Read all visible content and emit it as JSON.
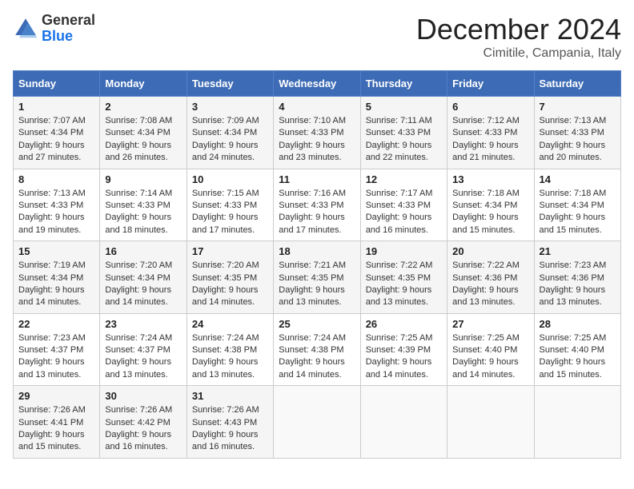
{
  "logo": {
    "general": "General",
    "blue": "Blue"
  },
  "header": {
    "month": "December 2024",
    "location": "Cimitile, Campania, Italy"
  },
  "weekdays": [
    "Sunday",
    "Monday",
    "Tuesday",
    "Wednesday",
    "Thursday",
    "Friday",
    "Saturday"
  ],
  "weeks": [
    [
      {
        "day": 1,
        "sunrise": "7:07 AM",
        "sunset": "4:34 PM",
        "daylight": "9 hours and 27 minutes."
      },
      {
        "day": 2,
        "sunrise": "7:08 AM",
        "sunset": "4:34 PM",
        "daylight": "9 hours and 26 minutes."
      },
      {
        "day": 3,
        "sunrise": "7:09 AM",
        "sunset": "4:34 PM",
        "daylight": "9 hours and 24 minutes."
      },
      {
        "day": 4,
        "sunrise": "7:10 AM",
        "sunset": "4:33 PM",
        "daylight": "9 hours and 23 minutes."
      },
      {
        "day": 5,
        "sunrise": "7:11 AM",
        "sunset": "4:33 PM",
        "daylight": "9 hours and 22 minutes."
      },
      {
        "day": 6,
        "sunrise": "7:12 AM",
        "sunset": "4:33 PM",
        "daylight": "9 hours and 21 minutes."
      },
      {
        "day": 7,
        "sunrise": "7:13 AM",
        "sunset": "4:33 PM",
        "daylight": "9 hours and 20 minutes."
      }
    ],
    [
      {
        "day": 8,
        "sunrise": "7:13 AM",
        "sunset": "4:33 PM",
        "daylight": "9 hours and 19 minutes."
      },
      {
        "day": 9,
        "sunrise": "7:14 AM",
        "sunset": "4:33 PM",
        "daylight": "9 hours and 18 minutes."
      },
      {
        "day": 10,
        "sunrise": "7:15 AM",
        "sunset": "4:33 PM",
        "daylight": "9 hours and 17 minutes."
      },
      {
        "day": 11,
        "sunrise": "7:16 AM",
        "sunset": "4:33 PM",
        "daylight": "9 hours and 17 minutes."
      },
      {
        "day": 12,
        "sunrise": "7:17 AM",
        "sunset": "4:33 PM",
        "daylight": "9 hours and 16 minutes."
      },
      {
        "day": 13,
        "sunrise": "7:18 AM",
        "sunset": "4:34 PM",
        "daylight": "9 hours and 15 minutes."
      },
      {
        "day": 14,
        "sunrise": "7:18 AM",
        "sunset": "4:34 PM",
        "daylight": "9 hours and 15 minutes."
      }
    ],
    [
      {
        "day": 15,
        "sunrise": "7:19 AM",
        "sunset": "4:34 PM",
        "daylight": "9 hours and 14 minutes."
      },
      {
        "day": 16,
        "sunrise": "7:20 AM",
        "sunset": "4:34 PM",
        "daylight": "9 hours and 14 minutes."
      },
      {
        "day": 17,
        "sunrise": "7:20 AM",
        "sunset": "4:35 PM",
        "daylight": "9 hours and 14 minutes."
      },
      {
        "day": 18,
        "sunrise": "7:21 AM",
        "sunset": "4:35 PM",
        "daylight": "9 hours and 13 minutes."
      },
      {
        "day": 19,
        "sunrise": "7:22 AM",
        "sunset": "4:35 PM",
        "daylight": "9 hours and 13 minutes."
      },
      {
        "day": 20,
        "sunrise": "7:22 AM",
        "sunset": "4:36 PM",
        "daylight": "9 hours and 13 minutes."
      },
      {
        "day": 21,
        "sunrise": "7:23 AM",
        "sunset": "4:36 PM",
        "daylight": "9 hours and 13 minutes."
      }
    ],
    [
      {
        "day": 22,
        "sunrise": "7:23 AM",
        "sunset": "4:37 PM",
        "daylight": "9 hours and 13 minutes."
      },
      {
        "day": 23,
        "sunrise": "7:24 AM",
        "sunset": "4:37 PM",
        "daylight": "9 hours and 13 minutes."
      },
      {
        "day": 24,
        "sunrise": "7:24 AM",
        "sunset": "4:38 PM",
        "daylight": "9 hours and 13 minutes."
      },
      {
        "day": 25,
        "sunrise": "7:24 AM",
        "sunset": "4:38 PM",
        "daylight": "9 hours and 14 minutes."
      },
      {
        "day": 26,
        "sunrise": "7:25 AM",
        "sunset": "4:39 PM",
        "daylight": "9 hours and 14 minutes."
      },
      {
        "day": 27,
        "sunrise": "7:25 AM",
        "sunset": "4:40 PM",
        "daylight": "9 hours and 14 minutes."
      },
      {
        "day": 28,
        "sunrise": "7:25 AM",
        "sunset": "4:40 PM",
        "daylight": "9 hours and 15 minutes."
      }
    ],
    [
      {
        "day": 29,
        "sunrise": "7:26 AM",
        "sunset": "4:41 PM",
        "daylight": "9 hours and 15 minutes."
      },
      {
        "day": 30,
        "sunrise": "7:26 AM",
        "sunset": "4:42 PM",
        "daylight": "9 hours and 16 minutes."
      },
      {
        "day": 31,
        "sunrise": "7:26 AM",
        "sunset": "4:43 PM",
        "daylight": "9 hours and 16 minutes."
      },
      null,
      null,
      null,
      null
    ]
  ],
  "labels": {
    "sunrise": "Sunrise:",
    "sunset": "Sunset:",
    "daylight": "Daylight:"
  }
}
